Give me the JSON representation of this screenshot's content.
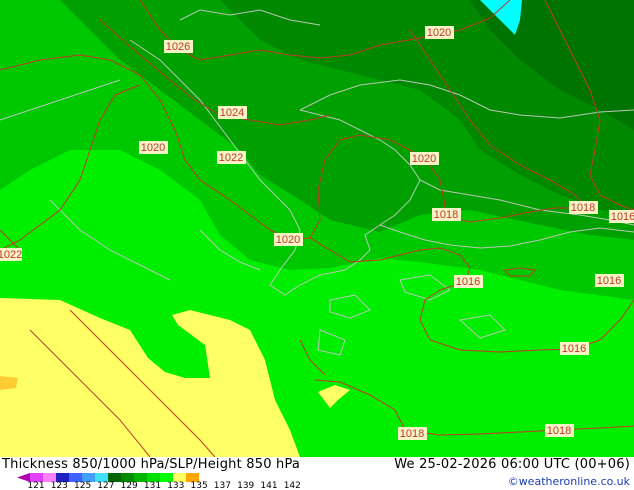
{
  "title": {
    "left": "Thickness 850/1000 hPa/SLP/Height 850 hPa",
    "right": "We 25-02-2026 06:00 UTC (00+06)"
  },
  "credit": "©weatheronline.co.uk",
  "legend": {
    "ticks": [
      "121",
      "123",
      "125",
      "127",
      "129",
      "131",
      "133",
      "135",
      "137",
      "139",
      "141",
      "142"
    ],
    "colors": [
      "#b000b0",
      "#e040ff",
      "#ff80ff",
      "#2020c0",
      "#4060ff",
      "#40a0ff",
      "#40e0ff",
      "#006400",
      "#008c00",
      "#00b400",
      "#00e000",
      "#00ff00",
      "#ffff66",
      "#ffa500"
    ]
  },
  "isobar_labels": [
    "1026",
    "1020",
    "1024",
    "1022",
    "1020",
    "1020",
    "1018",
    "1018",
    "1016",
    "1020",
    "1022",
    "1016",
    "1016",
    "1016",
    "1018",
    "1018"
  ],
  "colors": {
    "isobar": "#c0392b",
    "coast": "#b8c8b8",
    "label_bg": "#f6f3c6"
  }
}
